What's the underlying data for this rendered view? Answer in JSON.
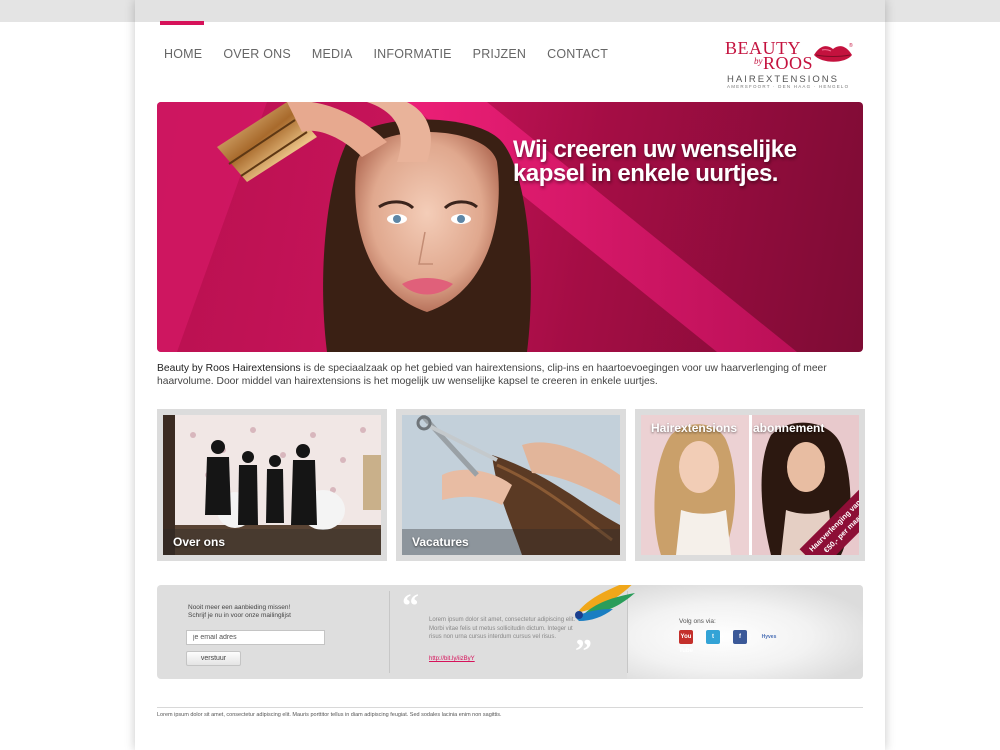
{
  "nav": {
    "items": [
      "HOME",
      "OVER ONS",
      "MEDIA",
      "INFORMATIE",
      "PRIJZEN",
      "CONTACT"
    ],
    "active": "HOME"
  },
  "logo": {
    "beauty": "BEAUTY",
    "by": "by",
    "roos": "ROOS",
    "hairextensions": "HAIREXTENSIONS",
    "cities": "AMERSFOORT · DEN HAAG · HENGELO",
    "trademark": "®"
  },
  "hero": {
    "line1": "Wij creeren uw wenselijke",
    "line2": "kapsel in enkele uurtjes."
  },
  "intro": {
    "brand": "Beauty by Roos  Hairextensions",
    "text": "  is de speciaalzaak op het gebied van hairextensions, clip-ins en haartoevoegingen voor uw haarverlenging of meer haarvolume. Door middel van hairextensions is het mogelijk uw wenselijke kapsel te creeren in enkele uurtjes."
  },
  "cards": {
    "over_ons": "Over ons",
    "vacatures": "Vacatures",
    "abon_left": "Hairextensions",
    "abon_right": "abonnement",
    "ribbon_line1": "Haarverlenging vanaf",
    "ribbon_line2": "€50,- per maand"
  },
  "newsletter": {
    "title": "Nooit meer een aanbieding missen!",
    "subtitle": "Schrijf je nu in voor onze mailinglijst",
    "placeholder": "je email adres",
    "button": "verstuur"
  },
  "quote": {
    "text": "Lorem ipsum dolor sit amet, consectetur adipiscing elit. Morbi vitae felis ut metus sollicitudin dictum. Integer ut risus non urna cursus interdum cursus vel risus.",
    "link": "http://bit.ly/iizByY"
  },
  "follow": {
    "label": "Volg ons via:",
    "youtube": "You Tube",
    "twitter": "t",
    "facebook": "f",
    "hyves": "Hyves"
  },
  "footer": {
    "text": "Lorem ipsum dolor sit amet, consectetur adipiscing elit. Mauris porttitor tellus in diam adipiscing feugiat. Sed sodales lacinia enim non sagittis."
  },
  "colors": {
    "accent": "#d6125a",
    "brand": "#c4123e",
    "hero_dark": "#7d0c34"
  }
}
